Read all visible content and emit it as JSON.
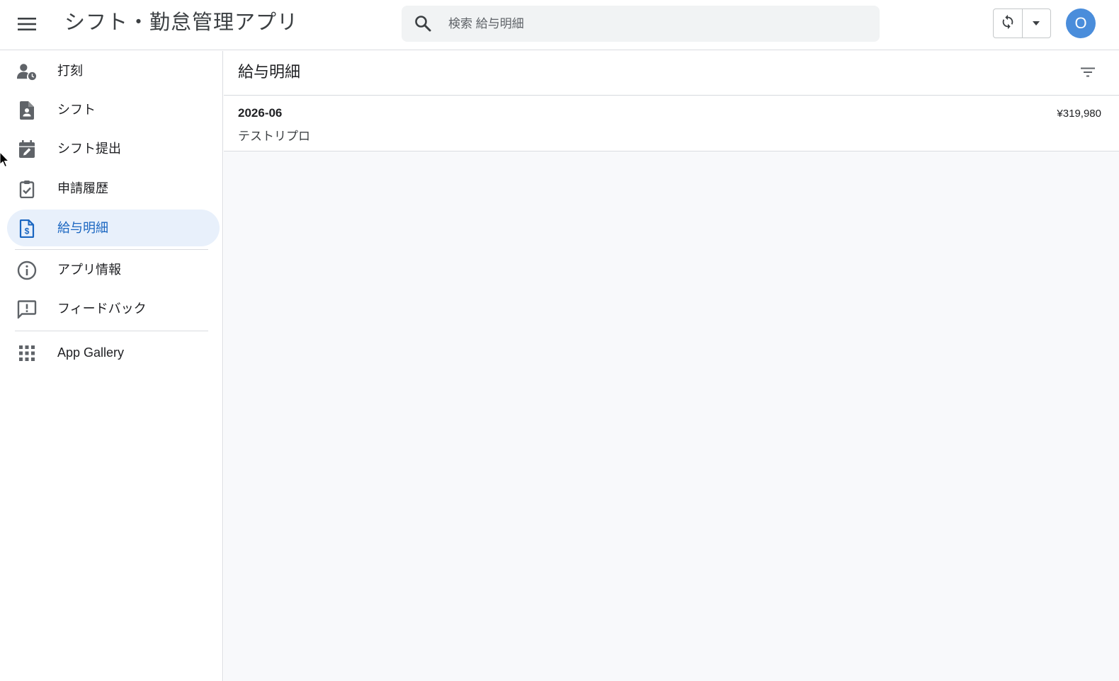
{
  "app": {
    "title": "シフト・勤怠管理アプリ"
  },
  "search": {
    "placeholder": "検索 給与明細",
    "icon": "search-icon"
  },
  "toolbar": {
    "sync_icon": "sync-icon",
    "dropdown_icon": "arrow-drop-down-icon",
    "avatar_initial": "O",
    "avatar_color": "#4a8ddb"
  },
  "sidebar": {
    "items": [
      {
        "label": "打刻",
        "icon": "person-clock-icon"
      },
      {
        "label": "シフト",
        "icon": "document-person-icon"
      },
      {
        "label": "シフト提出",
        "icon": "calendar-edit-icon"
      },
      {
        "label": "申請履歴",
        "icon": "clipboard-check-icon"
      },
      {
        "label": "給与明細",
        "icon": "document-dollar-icon",
        "active": true
      },
      {
        "label": "アプリ情報",
        "icon": "info-icon"
      },
      {
        "label": "フィードバック",
        "icon": "feedback-icon"
      },
      {
        "label": "App Gallery",
        "icon": "apps-grid-icon"
      }
    ]
  },
  "main": {
    "title": "給与明細",
    "filter_icon": "filter-icon",
    "rows": [
      {
        "period": "2026-06",
        "name": "テストリプロ",
        "amount": "¥319,980"
      }
    ]
  },
  "colors": {
    "accent": "#1a66c1",
    "active_bg": "#e8f0fb",
    "icon": "#5f6368",
    "main_bg": "#f8f9fb"
  }
}
